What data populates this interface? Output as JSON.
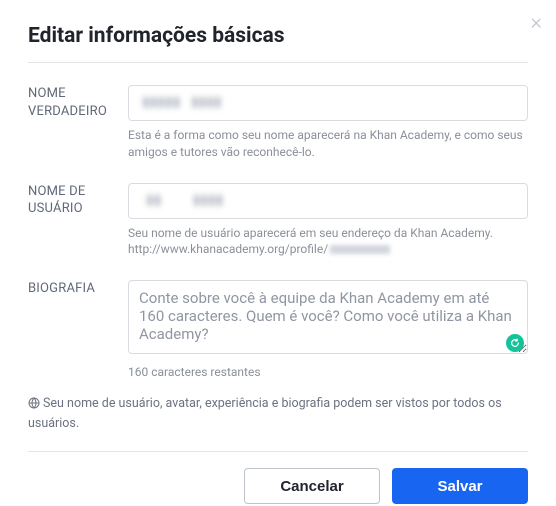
{
  "modal": {
    "title": "Editar informações básicas",
    "close_label": "×"
  },
  "realName": {
    "label": "NOME VERDADEIRO",
    "value": "",
    "helper": "Esta é a forma como seu nome aparecerá na Khan Academy, e como seus amigos e tutores vão reconhecê-lo."
  },
  "username": {
    "label": "NOME DE USUÁRIO",
    "value": "",
    "helper_line1": "Seu nome de usuário aparecerá em seu endereço da Khan Academy.",
    "helper_url_prefix": "http://www.khanacademy.org/profile/"
  },
  "bio": {
    "label": "BIOGRAFIA",
    "placeholder": "Conte sobre você à equipe da Khan Academy em até 160 caracteres. Quem é você? Como você utiliza a Khan Academy?",
    "value": "",
    "counter": "160 caracteres restantes"
  },
  "publicNote": "Seu nome de usuário, avatar, experiência e biografia podem ser vistos por todos os usuários.",
  "buttons": {
    "cancel": "Cancelar",
    "save": "Salvar"
  }
}
